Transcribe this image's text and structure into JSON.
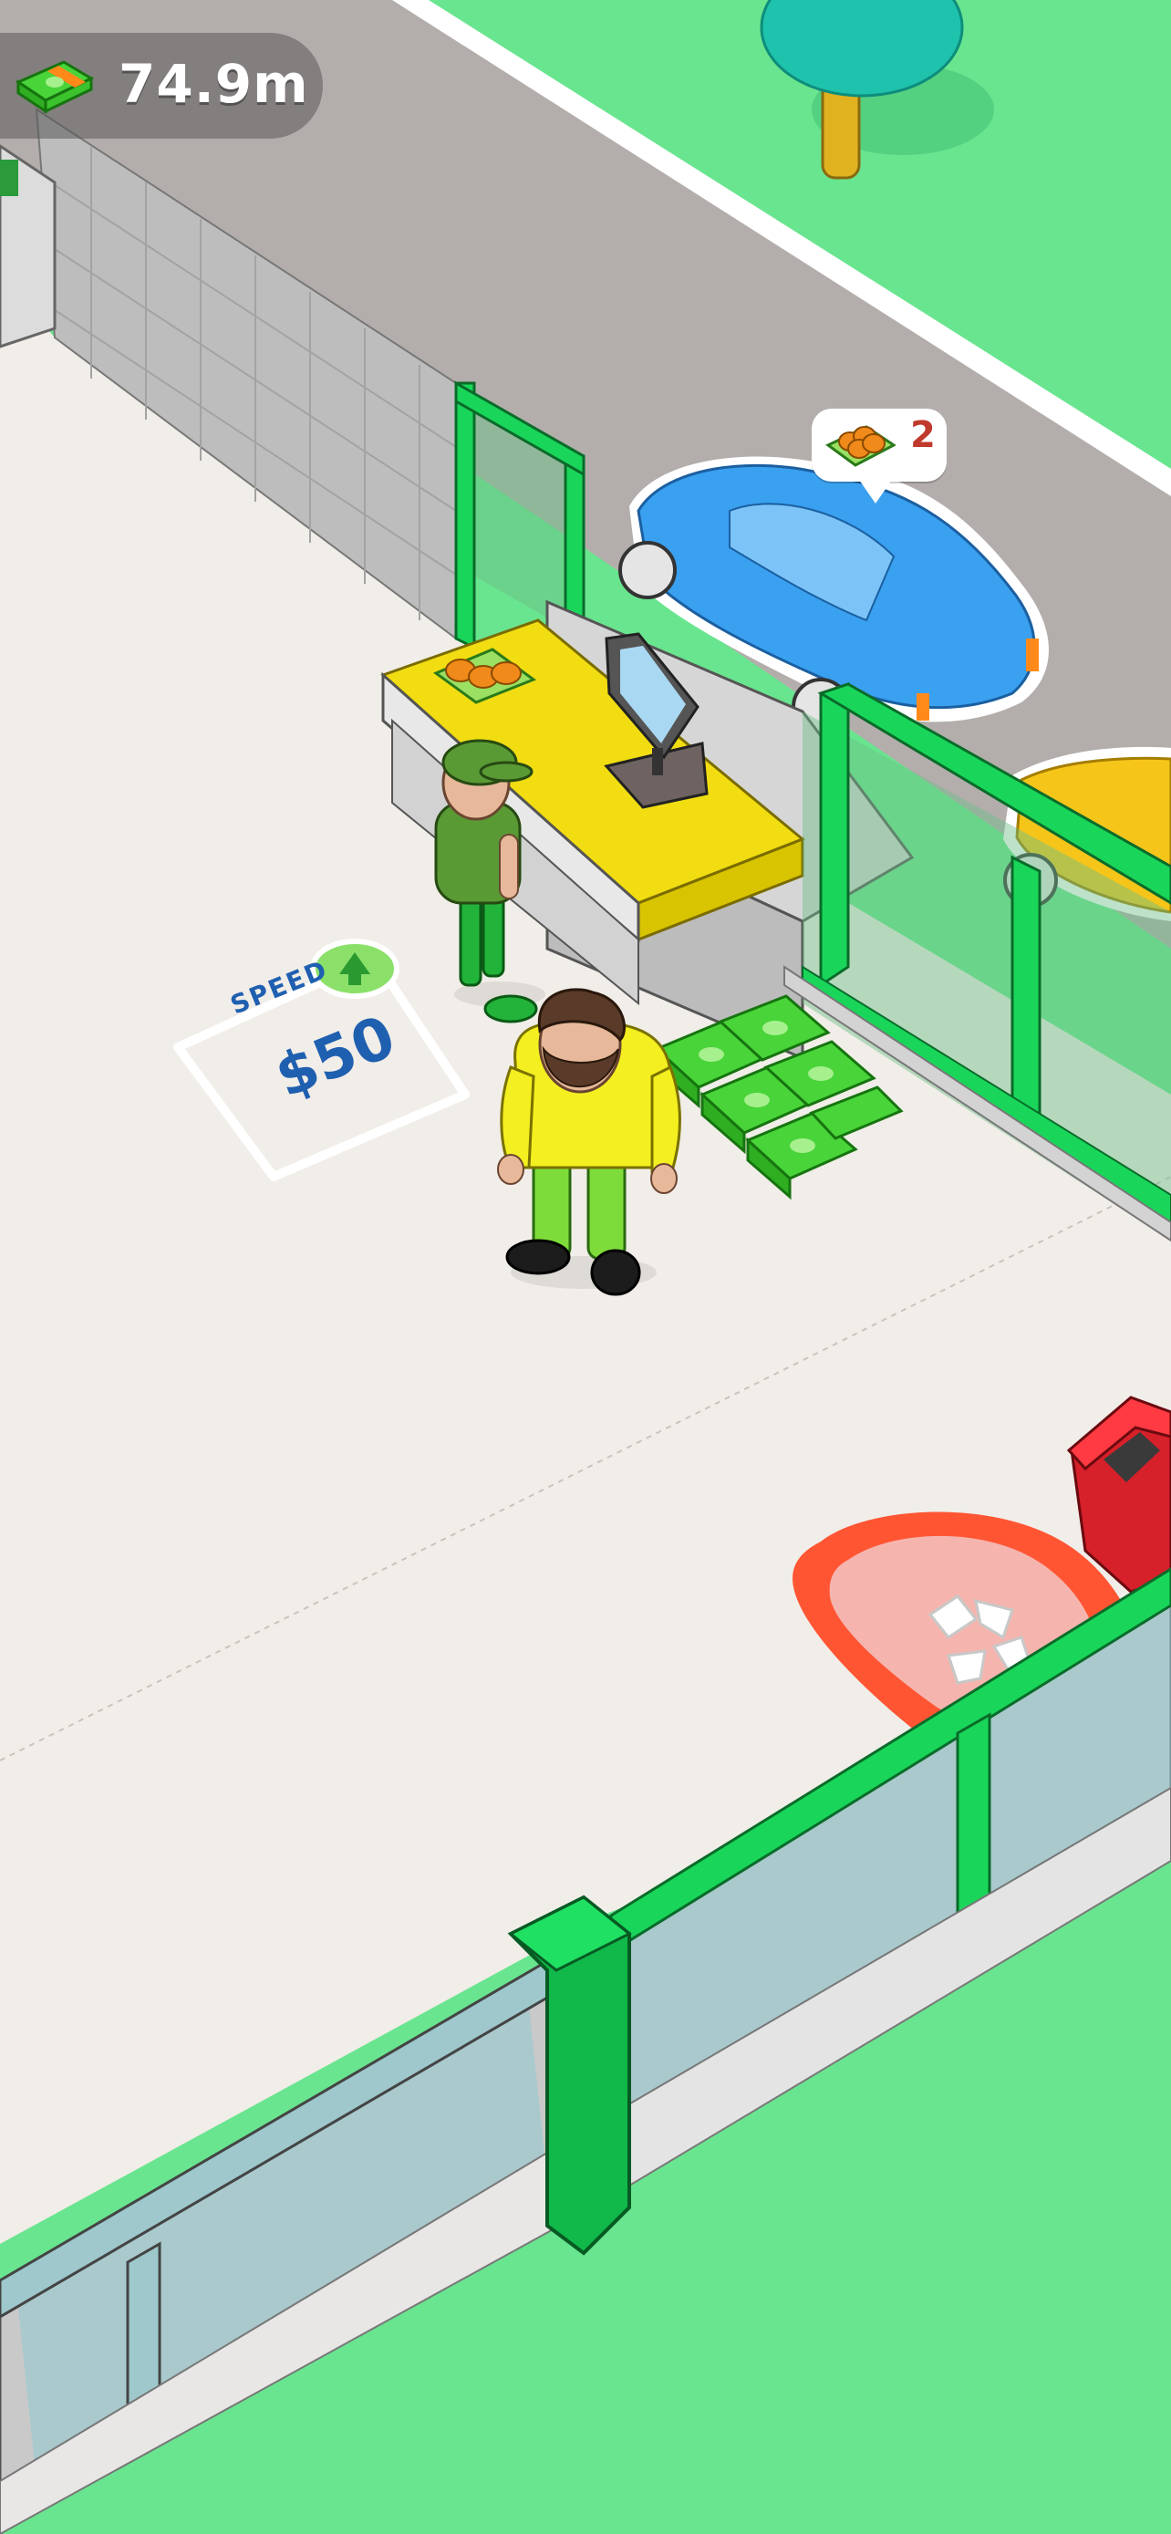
{
  "hud": {
    "money_icon": "cash-stack-icon",
    "money_value": "74.9m"
  },
  "order_bubble": {
    "item_icon": "burger-tray-icon",
    "count": "2"
  },
  "upgrade_pad": {
    "label": "SPEED",
    "price": "$50",
    "icon": "up-arrow-icon"
  },
  "colors": {
    "grass": "#69e58f",
    "road": "#b3aeab",
    "floor": "#f1ede8",
    "counter": "#f1dd12",
    "cash": "#49d43a",
    "glass_frame": "#19d65a",
    "car_blue": "#3aa0f0",
    "car_yellow": "#f5c51a",
    "trash_pad": "#ff5533",
    "trash_can": "#d6202a"
  }
}
